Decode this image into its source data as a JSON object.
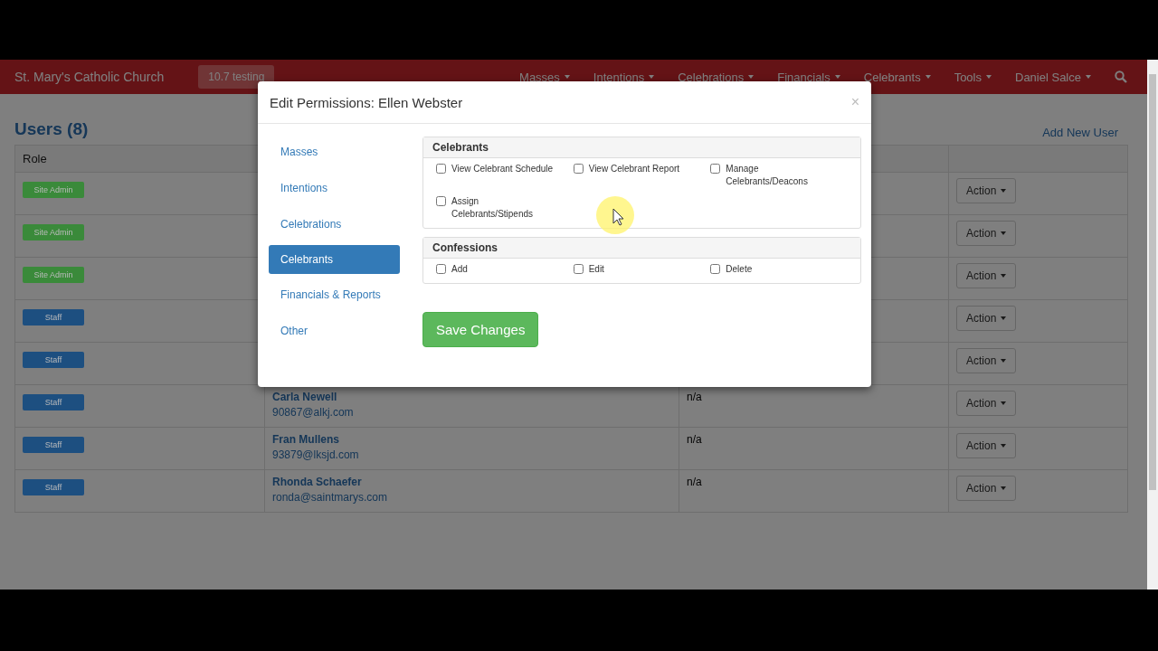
{
  "navbar": {
    "brand": "St. Mary's Catholic Church",
    "badge": "10.7 testing",
    "menu": [
      {
        "label": "Masses"
      },
      {
        "label": "Intentions"
      },
      {
        "label": "Celebrations"
      },
      {
        "label": "Financials"
      },
      {
        "label": "Celebrants"
      },
      {
        "label": "Tools"
      },
      {
        "label": "Daniel Salce"
      }
    ]
  },
  "page": {
    "title": "Users (8)",
    "add_link": "Add New User"
  },
  "table": {
    "columns": [
      "Role"
    ],
    "rows": [
      {
        "role": "Site Admin",
        "color": "#3a8a3a",
        "action": "Action"
      },
      {
        "role": "Site Admin",
        "color": "#3a8a3a",
        "action": "Action"
      },
      {
        "role": "Site Admin",
        "color": "#3a8a3a",
        "action": "Action"
      },
      {
        "role": "Staff",
        "color": "#1d4f80",
        "action": "Action"
      },
      {
        "role": "Staff",
        "color": "#1d4f80",
        "action": "Action"
      },
      {
        "role": "Staff",
        "color": "#1d4f80",
        "name": "Carla Newell",
        "email": "90867@alkj.com",
        "column_3": "n/a",
        "action": "Action"
      },
      {
        "role": "Staff",
        "color": "#1d4f80",
        "name": "Fran Mullens",
        "email": "93879@lksjd.com",
        "column_3": "n/a",
        "action": "Action"
      },
      {
        "role": "Staff",
        "color": "#1d4f80",
        "name": "Rhonda Schaefer",
        "email": "ronda@saintmarys.com",
        "column_3": "n/a",
        "action": "Action"
      }
    ]
  },
  "modal": {
    "title": "Edit Permissions: Ellen Webster",
    "close": "×",
    "nav": [
      {
        "label": "Masses",
        "selected": false
      },
      {
        "label": "Intentions",
        "selected": false
      },
      {
        "label": "Celebrations",
        "selected": false
      },
      {
        "label": "Celebrants",
        "selected": true
      },
      {
        "label": "Financials & Reports",
        "selected": false
      },
      {
        "label": "Other",
        "selected": false
      }
    ],
    "panels": [
      {
        "title": "Celebrants",
        "options": [
          {
            "label": "View Celebrant Schedule",
            "checked": false
          },
          {
            "label": "View Celebrant Report",
            "checked": false
          },
          {
            "label": "Manage Celebrants/Deacons",
            "checked": false
          },
          {
            "label": "Assign Celebrants/Stipends",
            "checked": false
          }
        ]
      },
      {
        "title": "Confessions",
        "options": [
          {
            "label": "Add",
            "checked": false
          },
          {
            "label": "Edit",
            "checked": false
          },
          {
            "label": "Delete",
            "checked": false
          }
        ]
      }
    ],
    "save": "Save Changes"
  }
}
